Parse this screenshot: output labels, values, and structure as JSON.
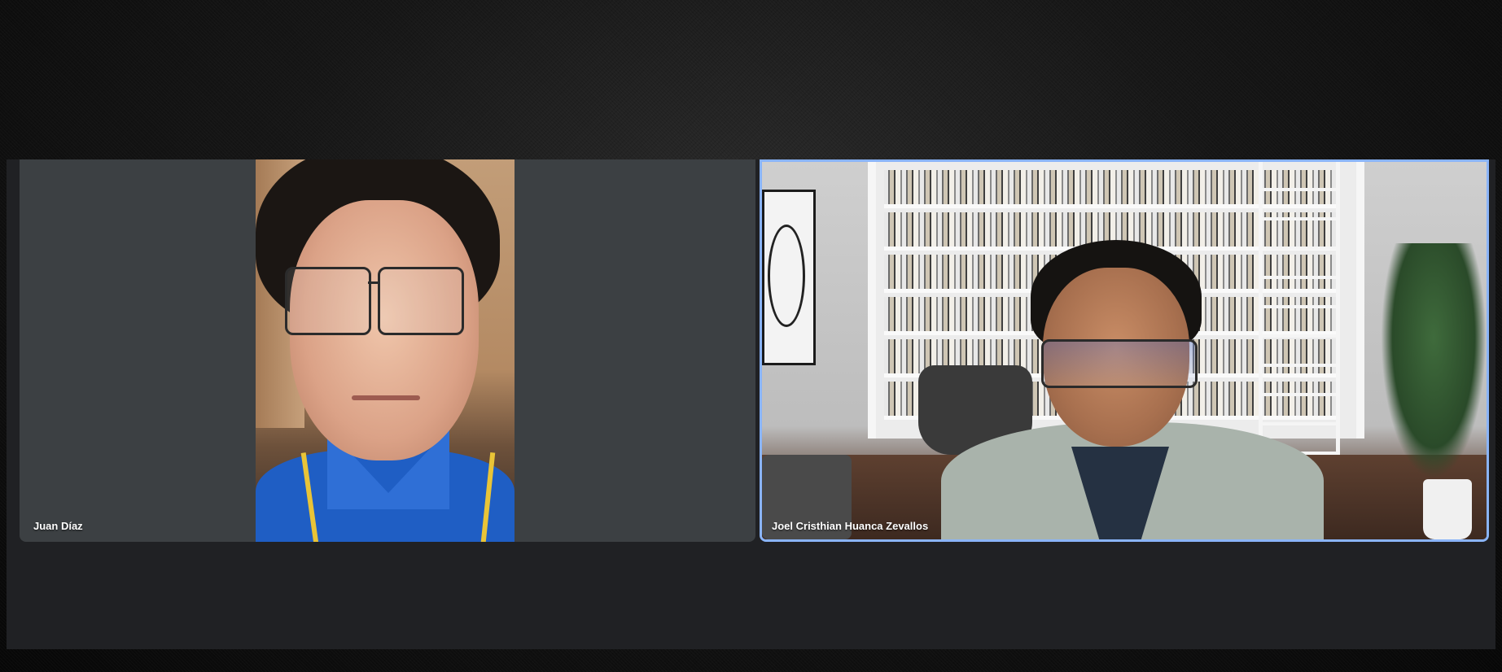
{
  "participants": [
    {
      "name": "Juan Díaz"
    },
    {
      "name": "Joel Cristhian Huanca Zevallos"
    }
  ],
  "active_speaker_accent": "#8ab4f8",
  "tile_background": "#3c4043",
  "stage_background": "#202124"
}
